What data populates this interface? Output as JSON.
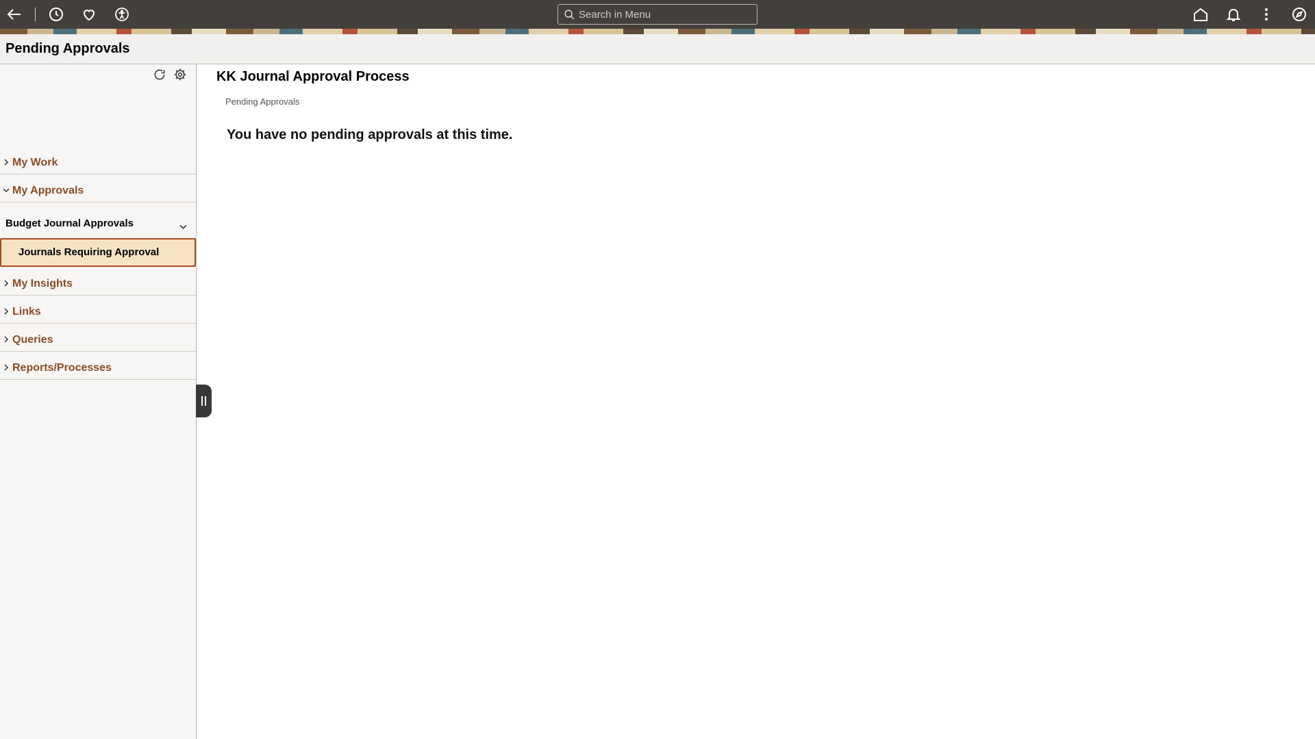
{
  "topbar": {
    "search_placeholder": "Search in Menu",
    "icons": [
      "back-arrow-icon",
      "history-clock-icon",
      "favorites-heart-icon",
      "accessibility-icon",
      "home-icon",
      "notifications-bell-icon",
      "actions-menu-icon",
      "navigator-compass-icon"
    ]
  },
  "page": {
    "title": "Pending Approvals"
  },
  "sidebar": {
    "sections": [
      {
        "label": "My Work",
        "expanded": false
      },
      {
        "label": "My Approvals",
        "expanded": true
      },
      {
        "label": "My Insights",
        "expanded": false
      },
      {
        "label": "Links",
        "expanded": false
      },
      {
        "label": "Queries",
        "expanded": false
      },
      {
        "label": "Reports/Processes",
        "expanded": false
      }
    ],
    "approvals_group": {
      "label": "Budget Journal Approvals",
      "selected_item": "Journals Requiring Approval"
    }
  },
  "main": {
    "title": "KK Journal Approval Process",
    "breadcrumb": "Pending Approvals",
    "message": "You have no pending approvals at this time."
  },
  "colors": {
    "banner": "#43403c",
    "link": "#8a4d25",
    "selected_bg": "#f5e3c4",
    "selected_border": "#a8491f"
  }
}
